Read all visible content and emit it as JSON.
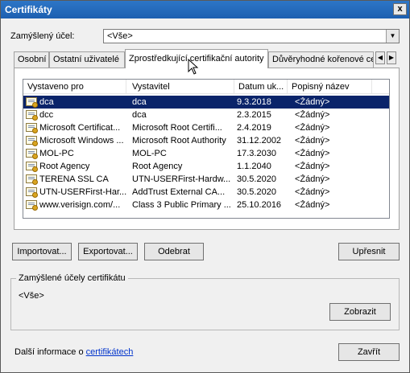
{
  "window": {
    "title": "Certifikáty",
    "close_label": "x"
  },
  "purpose": {
    "label": "Zamýšlený účel:",
    "value": "<Vše>"
  },
  "tabs": [
    {
      "label": "Osobní"
    },
    {
      "label": "Ostatní uživatelé"
    },
    {
      "label": "Zprostředkující certifikační autority"
    },
    {
      "label": "Důvěryhodné kořenové ce"
    }
  ],
  "list": {
    "columns": [
      "Vystaveno pro",
      "Vystavitel",
      "Datum uk...",
      "Popisný název"
    ],
    "rows": [
      {
        "issued_to": "dca",
        "issuer": "dca",
        "date": "9.3.2018",
        "name": "<Žádný>"
      },
      {
        "issued_to": "dcc",
        "issuer": "dca",
        "date": "2.3.2015",
        "name": "<Žádný>"
      },
      {
        "issued_to": "Microsoft Certificat...",
        "issuer": "Microsoft Root Certifi...",
        "date": "2.4.2019",
        "name": "<Žádný>"
      },
      {
        "issued_to": "Microsoft Windows ...",
        "issuer": "Microsoft Root Authority",
        "date": "31.12.2002",
        "name": "<Žádný>"
      },
      {
        "issued_to": "MOL-PC",
        "issuer": "MOL-PC",
        "date": "17.3.2030",
        "name": "<Žádný>"
      },
      {
        "issued_to": "Root Agency",
        "issuer": "Root Agency",
        "date": "1.1.2040",
        "name": "<Žádný>"
      },
      {
        "issued_to": "TERENA SSL CA",
        "issuer": "UTN-USERFirst-Hardw...",
        "date": "30.5.2020",
        "name": "<Žádný>"
      },
      {
        "issued_to": "UTN-USERFirst-Har...",
        "issuer": "AddTrust External CA...",
        "date": "30.5.2020",
        "name": "<Žádný>"
      },
      {
        "issued_to": "www.verisign.com/...",
        "issuer": "Class 3 Public Primary ...",
        "date": "25.10.2016",
        "name": "<Žádný>"
      }
    ]
  },
  "buttons": {
    "import": "Importovat...",
    "export": "Exportovat...",
    "remove": "Odebrat",
    "advanced": "Upřesnit",
    "view": "Zobrazit",
    "close": "Zavřít"
  },
  "purposes_group": {
    "title": "Zamýšlené účely certifikátu",
    "value": "<Vše>"
  },
  "footer": {
    "text": "Další informace o ",
    "link": "certifikátech"
  }
}
